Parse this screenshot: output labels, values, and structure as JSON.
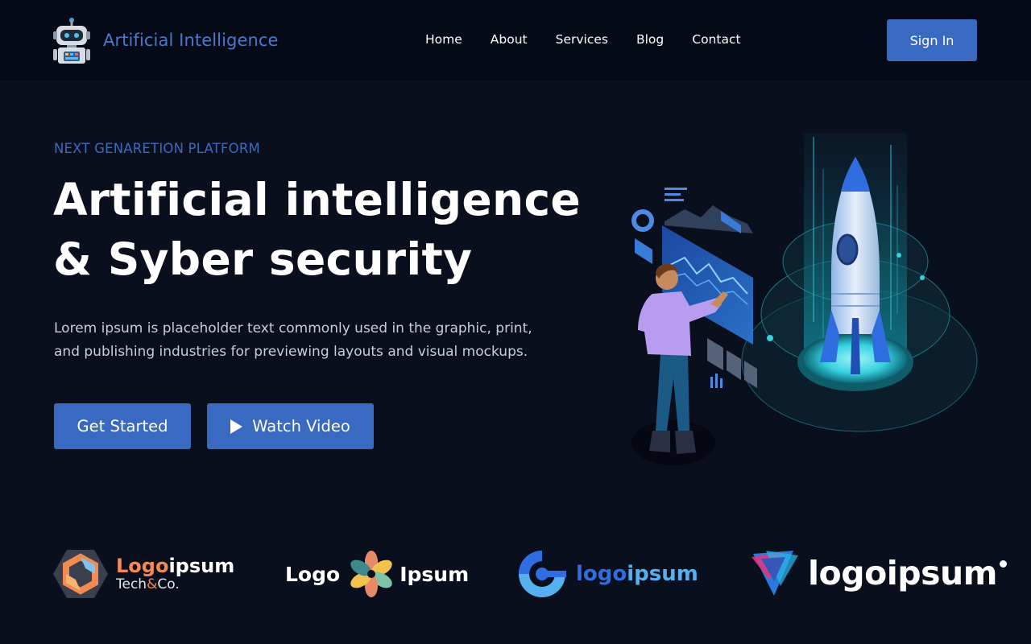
{
  "navbar": {
    "brand": {
      "icon": "robot-icon",
      "title": "Artificial Intelligence"
    },
    "links": [
      "Home",
      "About",
      "Services",
      "Blog",
      "Contact"
    ],
    "sign_in": "Sign In"
  },
  "hero": {
    "eyebrow": "NEXT GENARETION PLATFORM",
    "headline_line1": "Artificial intelligence",
    "headline_line2": "& Syber security",
    "description_line1": "Lorem ipsum is placeholder text commonly used in the graphic, print,",
    "description_line2": "and publishing industries for previewing layouts and visual mockups.",
    "get_started": "Get Started",
    "watch_video": "Watch Video",
    "watch_video_icon": "play-icon",
    "illustration": "rocket-dashboard-illustration"
  },
  "partner_logos": {
    "logo1": {
      "word1": "Logo",
      "word2": "ipsum",
      "sub1": "Tech",
      "amp": "&",
      "sub2": "Co."
    },
    "logo2": {
      "word1": "Logo",
      "word2": "Ipsum"
    },
    "logo3": {
      "word1": "logo",
      "word2": "ipsum"
    },
    "logo4": {
      "word": "logoipsum"
    }
  },
  "colors": {
    "background": "#0a0f1e",
    "navbar": "#050a17",
    "accent": "#3a69c2",
    "eyebrow": "#3d69bf",
    "text_muted": "#c7cdd9"
  }
}
